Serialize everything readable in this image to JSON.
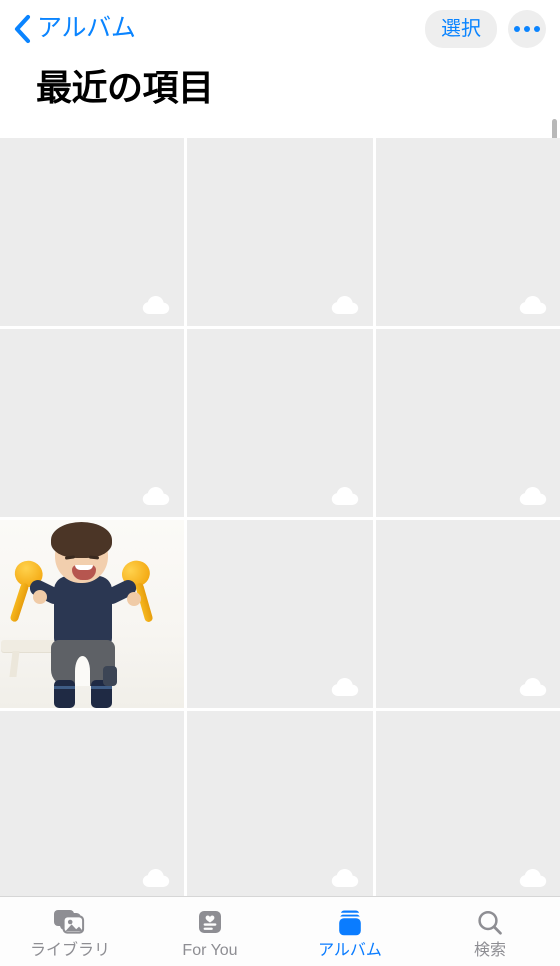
{
  "app": {
    "name": "Photos",
    "accent_color": "#0a84ff",
    "inactive_color": "#8e8e93",
    "placeholder_color": "#ececec",
    "chrome_background": "#ffffff"
  },
  "navbar": {
    "back_label": "アルバム",
    "back_icon": "chevron-left-icon",
    "select_label": "選択",
    "more_icon": "ellipsis-icon"
  },
  "header": {
    "title": "最近の項目"
  },
  "scrollbar": {
    "visible": true
  },
  "grid": {
    "columns": 3,
    "cells": [
      {
        "id": "cell-1",
        "type": "placeholder",
        "badge": "icloud-cloud-icon",
        "badge_visible": true
      },
      {
        "id": "cell-2",
        "type": "placeholder",
        "badge": "icloud-cloud-icon",
        "badge_visible": true
      },
      {
        "id": "cell-3",
        "type": "placeholder",
        "badge": "icloud-cloud-icon",
        "badge_visible": true
      },
      {
        "id": "cell-4",
        "type": "placeholder",
        "badge": "icloud-cloud-icon",
        "badge_visible": true
      },
      {
        "id": "cell-5",
        "type": "placeholder",
        "badge": "icloud-cloud-icon",
        "badge_visible": true
      },
      {
        "id": "cell-6",
        "type": "placeholder",
        "badge": "icloud-cloud-icon",
        "badge_visible": true
      },
      {
        "id": "cell-7",
        "type": "photo",
        "description": "赤ちゃんがマラカスを持って笑っている写真",
        "badge_visible": false
      },
      {
        "id": "cell-8",
        "type": "placeholder",
        "badge": "icloud-cloud-icon",
        "badge_visible": true
      },
      {
        "id": "cell-9",
        "type": "placeholder",
        "badge": "icloud-cloud-icon",
        "badge_visible": true
      },
      {
        "id": "cell-10",
        "type": "placeholder",
        "badge": "icloud-cloud-icon",
        "badge_visible": true
      },
      {
        "id": "cell-11",
        "type": "placeholder",
        "badge": "icloud-cloud-icon",
        "badge_visible": true
      },
      {
        "id": "cell-12",
        "type": "placeholder",
        "badge": "icloud-cloud-icon",
        "badge_visible": true
      }
    ]
  },
  "tabbar": {
    "items": [
      {
        "label": "ライブラリ",
        "icon": "photo-stack-icon",
        "active": false
      },
      {
        "label": "For You",
        "icon": "for-you-card-icon",
        "active": false
      },
      {
        "label": "アルバム",
        "icon": "albums-book-icon",
        "active": true
      },
      {
        "label": "検索",
        "icon": "search-magnifier-icon",
        "active": false
      }
    ]
  }
}
